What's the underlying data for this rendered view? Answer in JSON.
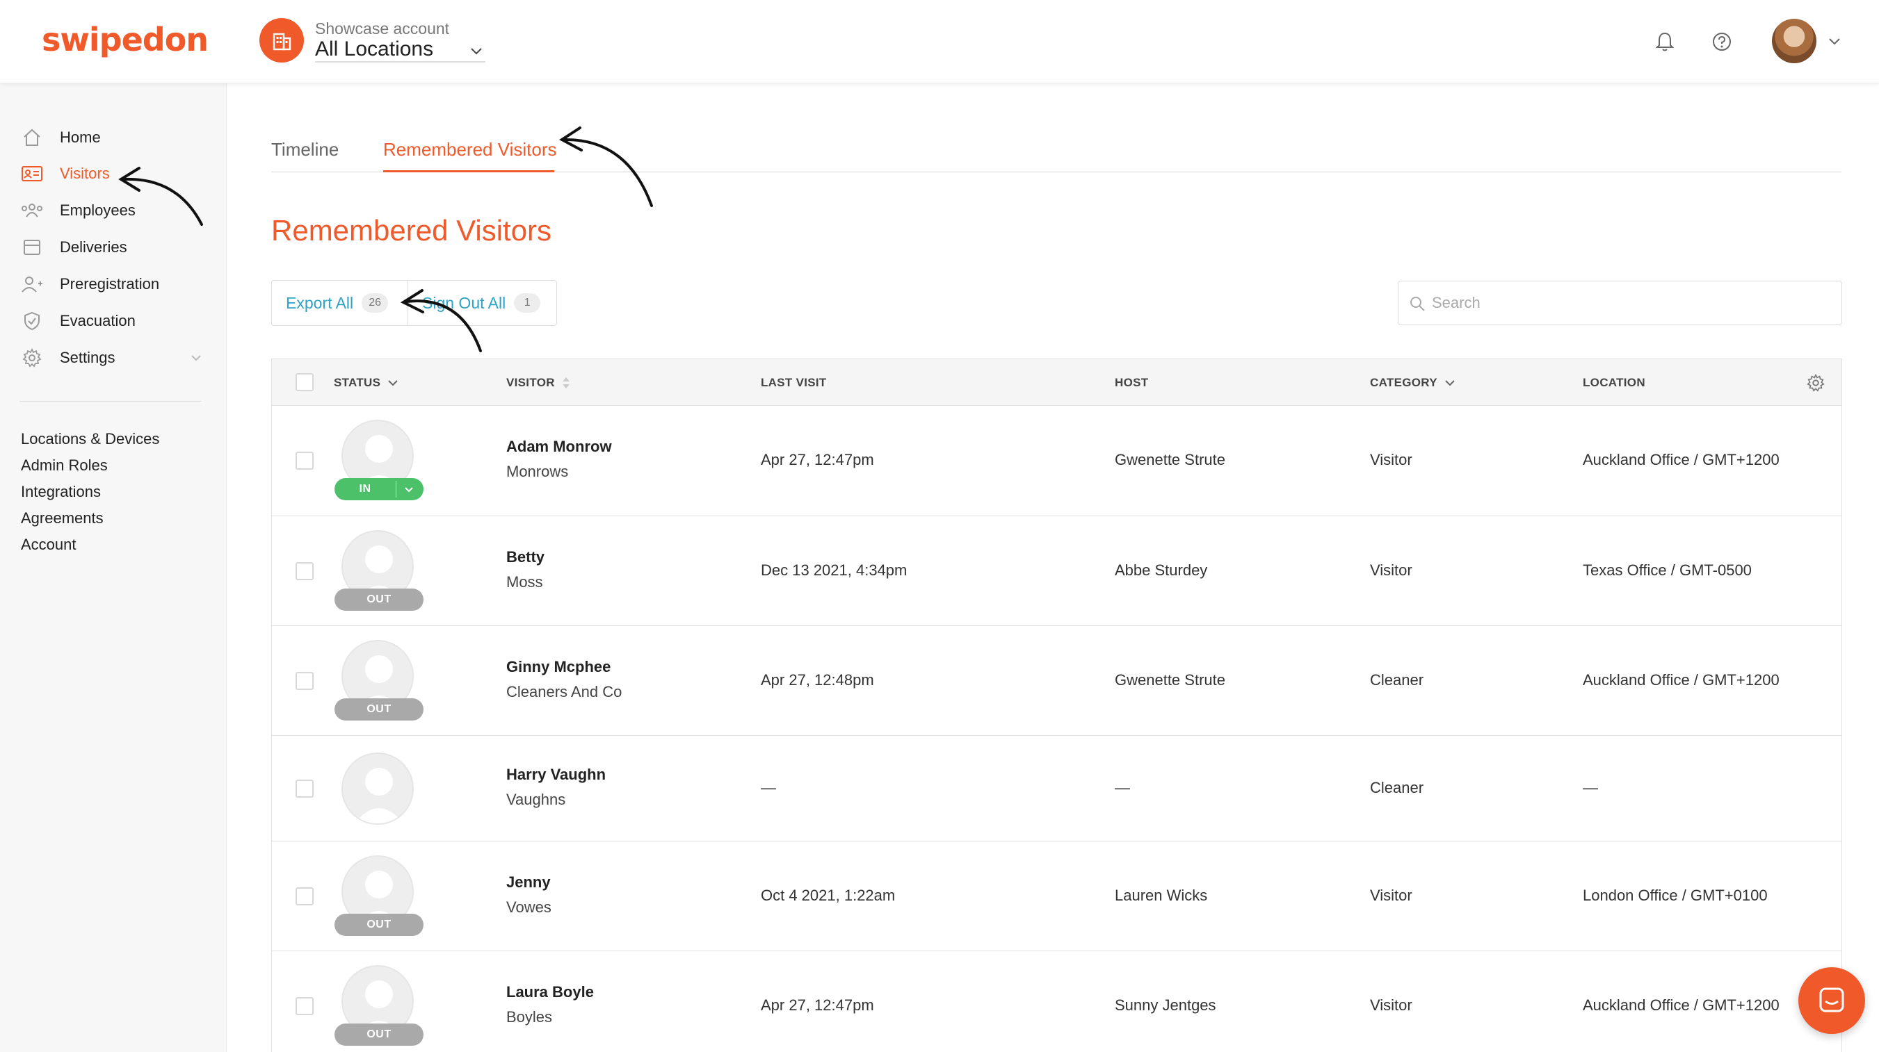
{
  "brand": {
    "logo_text": "swipedon",
    "accent": "#f05a2b",
    "link_color": "#2ea3c7"
  },
  "header": {
    "account_label": "Showcase account",
    "location": "All Locations",
    "icons": [
      "bell-icon",
      "help-icon"
    ]
  },
  "sidebar": {
    "items": [
      {
        "label": "Home",
        "icon": "home-icon"
      },
      {
        "label": "Visitors",
        "icon": "visitor-card-icon",
        "active": true
      },
      {
        "label": "Employees",
        "icon": "employees-icon"
      },
      {
        "label": "Deliveries",
        "icon": "deliveries-icon"
      },
      {
        "label": "Preregistration",
        "icon": "add-person-icon"
      },
      {
        "label": "Evacuation",
        "icon": "shield-icon"
      },
      {
        "label": "Settings",
        "icon": "gear-icon"
      }
    ],
    "links": [
      "Locations & Devices",
      "Admin Roles",
      "Integrations",
      "Agreements",
      "Account"
    ]
  },
  "tabs": [
    {
      "label": "Timeline",
      "active": false
    },
    {
      "label": "Remembered Visitors",
      "active": true
    }
  ],
  "page_title": "Remembered Visitors",
  "actions": {
    "export_label": "Export All",
    "export_count": "26",
    "signout_label": "Sign Out All",
    "signout_count": "1"
  },
  "search": {
    "placeholder": "Search",
    "value": ""
  },
  "table": {
    "columns": [
      "STATUS",
      "VISITOR",
      "LAST VISIT",
      "HOST",
      "CATEGORY",
      "LOCATION"
    ],
    "rows": [
      {
        "status": "IN",
        "name": "Adam Monrow",
        "company": "Monrows",
        "last_visit": "Apr 27, 12:47pm",
        "host": "Gwenette Strute",
        "category": "Visitor",
        "location": "Auckland Office / GMT+1200"
      },
      {
        "status": "OUT",
        "name": "Betty",
        "company": "Moss",
        "last_visit": "Dec 13 2021, 4:34pm",
        "host": "Abbe Sturdey",
        "category": "Visitor",
        "location": "Texas Office / GMT-0500"
      },
      {
        "status": "OUT",
        "name": "Ginny Mcphee",
        "company": "Cleaners And Co",
        "last_visit": "Apr 27, 12:48pm",
        "host": "Gwenette Strute",
        "category": "Cleaner",
        "location": "Auckland Office / GMT+1200"
      },
      {
        "status": "",
        "name": "Harry Vaughn",
        "company": "Vaughns",
        "last_visit": "—",
        "host": "—",
        "category": "Cleaner",
        "location": "—"
      },
      {
        "status": "OUT",
        "name": "Jenny",
        "company": "Vowes",
        "last_visit": "Oct 4 2021, 1:22am",
        "host": "Lauren Wicks",
        "category": "Visitor",
        "location": "London Office / GMT+0100"
      },
      {
        "status": "OUT",
        "name": "Laura Boyle",
        "company": "Boyles",
        "last_visit": "Apr 27, 12:47pm",
        "host": "Sunny Jentges",
        "category": "Visitor",
        "location": "Auckland Office / GMT+1200"
      }
    ]
  }
}
